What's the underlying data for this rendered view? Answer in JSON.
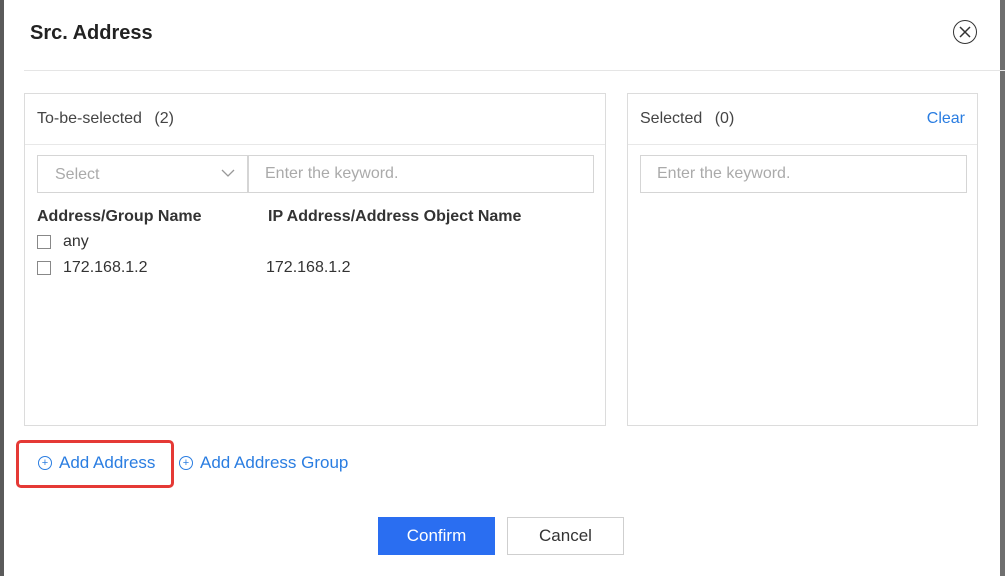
{
  "dialog": {
    "title": "Src. Address"
  },
  "left_panel": {
    "title": "To-be-selected",
    "count": "(2)",
    "select_placeholder": "Select",
    "search_placeholder": "Enter the keyword.",
    "columns": [
      "Address/Group Name",
      "IP Address/Address Object Name"
    ],
    "rows": [
      {
        "name": "any",
        "ip": ""
      },
      {
        "name": "172.168.1.2",
        "ip": "172.168.1.2"
      }
    ]
  },
  "right_panel": {
    "title": "Selected",
    "count": "(0)",
    "clear_label": "Clear",
    "search_placeholder": "Enter the keyword."
  },
  "actions": {
    "add_address": "Add Address",
    "add_address_group": "Add Address Group"
  },
  "footer": {
    "confirm": "Confirm",
    "cancel": "Cancel"
  },
  "colors": {
    "accent": "#2a7de1",
    "primary_button": "#2a6ef1",
    "highlight": "#e53935"
  }
}
